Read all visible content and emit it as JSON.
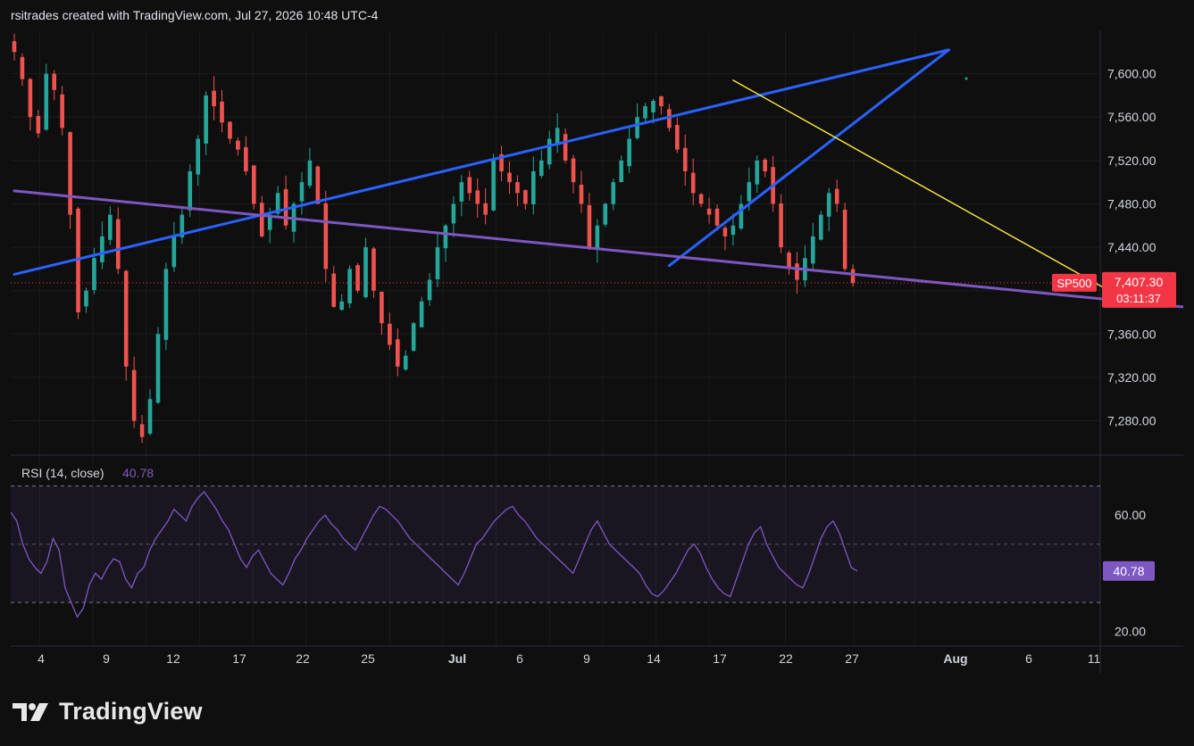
{
  "header": {
    "title": "rsitrades created with TradingView.com, Jul 27, 2026 10:48 UTC-4"
  },
  "brand": {
    "name": "TradingView",
    "icon": "tradingview-logo-icon"
  },
  "colors": {
    "up": "#26a69a",
    "down": "#ef5350",
    "blue_lines": "#2962ff",
    "purple_line": "#7e57c2",
    "yellow_line": "#ffeb3b",
    "rsi": "#7e57c2",
    "badge": "#f23645"
  },
  "chart_data": {
    "type": "candlestick",
    "symbol_badge": "SP500",
    "last_price": "7,407.30",
    "countdown": "03:11:37",
    "price_axis": {
      "ylim": [
        7250,
        7640
      ],
      "ticks": [
        "7,600.00",
        "7,560.00",
        "7,520.00",
        "7,480.00",
        "7,440.00",
        "7,400.00",
        "7,360.00",
        "7,320.00",
        "7,280.00"
      ],
      "tick_values": [
        7600,
        7560,
        7520,
        7480,
        7440,
        7400,
        7360,
        7320,
        7280
      ]
    },
    "x_axis": {
      "labels": [
        "4",
        "9",
        "12",
        "17",
        "22",
        "25",
        "Jul",
        "6",
        "9",
        "14",
        "17",
        "22",
        "27",
        "Aug",
        "6",
        "11"
      ],
      "label_positions": [
        0,
        7,
        14,
        21,
        28,
        35,
        46,
        53,
        60,
        67,
        74,
        81,
        88,
        98,
        107,
        115
      ]
    },
    "bar_count": 89,
    "closes": [
      7620,
      7595,
      7560,
      7545,
      7600,
      7585,
      7550,
      7470,
      7380,
      7400,
      7430,
      7450,
      7470,
      7420,
      7330,
      7280,
      7265,
      7300,
      7360,
      7420,
      7450,
      7470,
      7510,
      7540,
      7580,
      7570,
      7555,
      7540,
      7530,
      7510,
      7480,
      7450,
      7470,
      7490,
      7460,
      7480,
      7500,
      7520,
      7480,
      7420,
      7385,
      7390,
      7420,
      7400,
      7440,
      7400,
      7370,
      7350,
      7330,
      7340,
      7370,
      7390,
      7410,
      7440,
      7460,
      7480,
      7500,
      7490,
      7480,
      7470,
      7520,
      7510,
      7500,
      7490,
      7480,
      7510,
      7520,
      7540,
      7550,
      7520,
      7500,
      7480,
      7440,
      7460,
      7480,
      7500,
      7520,
      7540,
      7560,
      7570,
      7575,
      7570,
      7550,
      7530,
      7510,
      7490,
      7480,
      7470,
      7460,
      7450,
      7460,
      7480,
      7500,
      7520,
      7510,
      7480,
      7440,
      7420,
      7410,
      7430,
      7450,
      7470,
      7490,
      7480,
      7420,
      7407
    ],
    "drawings": [
      {
        "name": "blue-upper-trendline",
        "from": {
          "bar": 0,
          "price": 7415
        },
        "to": {
          "bar": 117,
          "price": 7622
        }
      },
      {
        "name": "blue-steep-trendline",
        "from": {
          "bar": 82,
          "price": 7423
        },
        "to": {
          "bar": 117,
          "price": 7622
        }
      },
      {
        "name": "purple-support-trendline",
        "from": {
          "bar": 0,
          "price": 7492
        },
        "to": {
          "bar": 164,
          "price": 7372
        }
      },
      {
        "name": "yellow-resistance-trendline",
        "from": {
          "bar": 90,
          "price": 7594
        },
        "to": {
          "bar": 139,
          "price": 7392
        }
      }
    ],
    "rsi": {
      "label": "RSI (14, close)",
      "value": "40.78",
      "ticks": [
        "60.00",
        "20.00"
      ],
      "tick_values": [
        60,
        20
      ],
      "ylim": [
        15,
        80
      ],
      "band": [
        30,
        70
      ],
      "series": [
        61,
        58,
        50,
        45,
        42,
        40,
        44,
        52,
        48,
        35,
        30,
        25,
        28,
        36,
        40,
        38,
        42,
        45,
        44,
        38,
        35,
        40,
        42,
        48,
        52,
        55,
        58,
        62,
        60,
        58,
        63,
        66,
        68,
        65,
        62,
        58,
        55,
        50,
        45,
        42,
        46,
        48,
        44,
        40,
        38,
        36,
        40,
        45,
        48,
        52,
        55,
        58,
        60,
        57,
        55,
        52,
        50,
        48,
        52,
        56,
        60,
        63,
        62,
        60,
        58,
        55,
        52,
        50,
        48,
        46,
        44,
        42,
        40,
        38,
        36,
        40,
        45,
        50,
        52,
        55,
        58,
        60,
        62,
        63,
        60,
        58,
        55,
        52,
        50,
        48,
        46,
        44,
        42,
        40,
        45,
        50,
        55,
        58,
        54,
        50,
        48,
        46,
        44,
        42,
        40,
        36,
        33,
        32,
        34,
        37,
        40,
        44,
        48,
        50,
        47,
        42,
        38,
        35,
        33,
        32,
        38,
        44,
        50,
        54,
        56,
        50,
        46,
        42,
        40,
        38,
        36,
        35,
        40,
        46,
        52,
        56,
        58,
        54,
        48,
        42,
        40.78
      ]
    }
  }
}
